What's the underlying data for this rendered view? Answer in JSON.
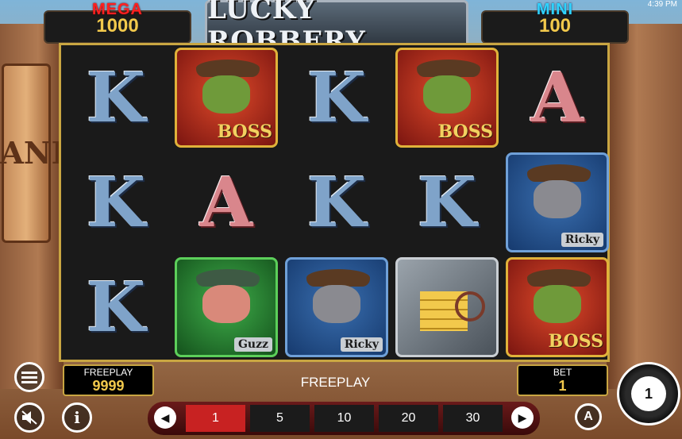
{
  "status": {
    "clock": "4:39 PM"
  },
  "scene": {
    "bank_sign": "BANK"
  },
  "jackpots": {
    "mega": {
      "label": "MEGA",
      "value": "1000"
    },
    "mini": {
      "label": "MINI",
      "value": "100"
    }
  },
  "logo": {
    "title": "LUCKY ROBBERY"
  },
  "reels": [
    [
      {
        "kind": "letter",
        "text": "K"
      },
      {
        "kind": "letter",
        "text": "K"
      },
      {
        "kind": "letter",
        "text": "K"
      }
    ],
    [
      {
        "kind": "boss",
        "tag": "BOSS"
      },
      {
        "kind": "letter",
        "text": "A"
      },
      {
        "kind": "guzz",
        "tag": "Guzz"
      }
    ],
    [
      {
        "kind": "letter",
        "text": "K"
      },
      {
        "kind": "letter",
        "text": "K"
      },
      {
        "kind": "ricky",
        "tag": "Ricky"
      }
    ],
    [
      {
        "kind": "boss",
        "tag": "BOSS"
      },
      {
        "kind": "letter",
        "text": "K"
      },
      {
        "kind": "vault",
        "tag": ""
      }
    ],
    [
      {
        "kind": "letter",
        "text": "A"
      },
      {
        "kind": "ricky",
        "tag": "Ricky"
      },
      {
        "kind": "boss",
        "tag": "BOSS"
      }
    ]
  ],
  "bottom": {
    "freeplay_label": "FREEPLAY",
    "freeplay_value": "9999",
    "mode_text": "FREEPLAY",
    "bet_label": "BET",
    "bet_value": "1",
    "lines": [
      "1",
      "5",
      "10",
      "20",
      "30"
    ],
    "active_line_index": 0,
    "auto_label": "A",
    "spin_label": "1"
  },
  "icons": {
    "menu": "menu-icon",
    "sound": "sound-muted-icon",
    "info": "info-icon",
    "prev": "chevron-left-icon",
    "next": "chevron-right-icon",
    "spin": "spin-icon"
  }
}
